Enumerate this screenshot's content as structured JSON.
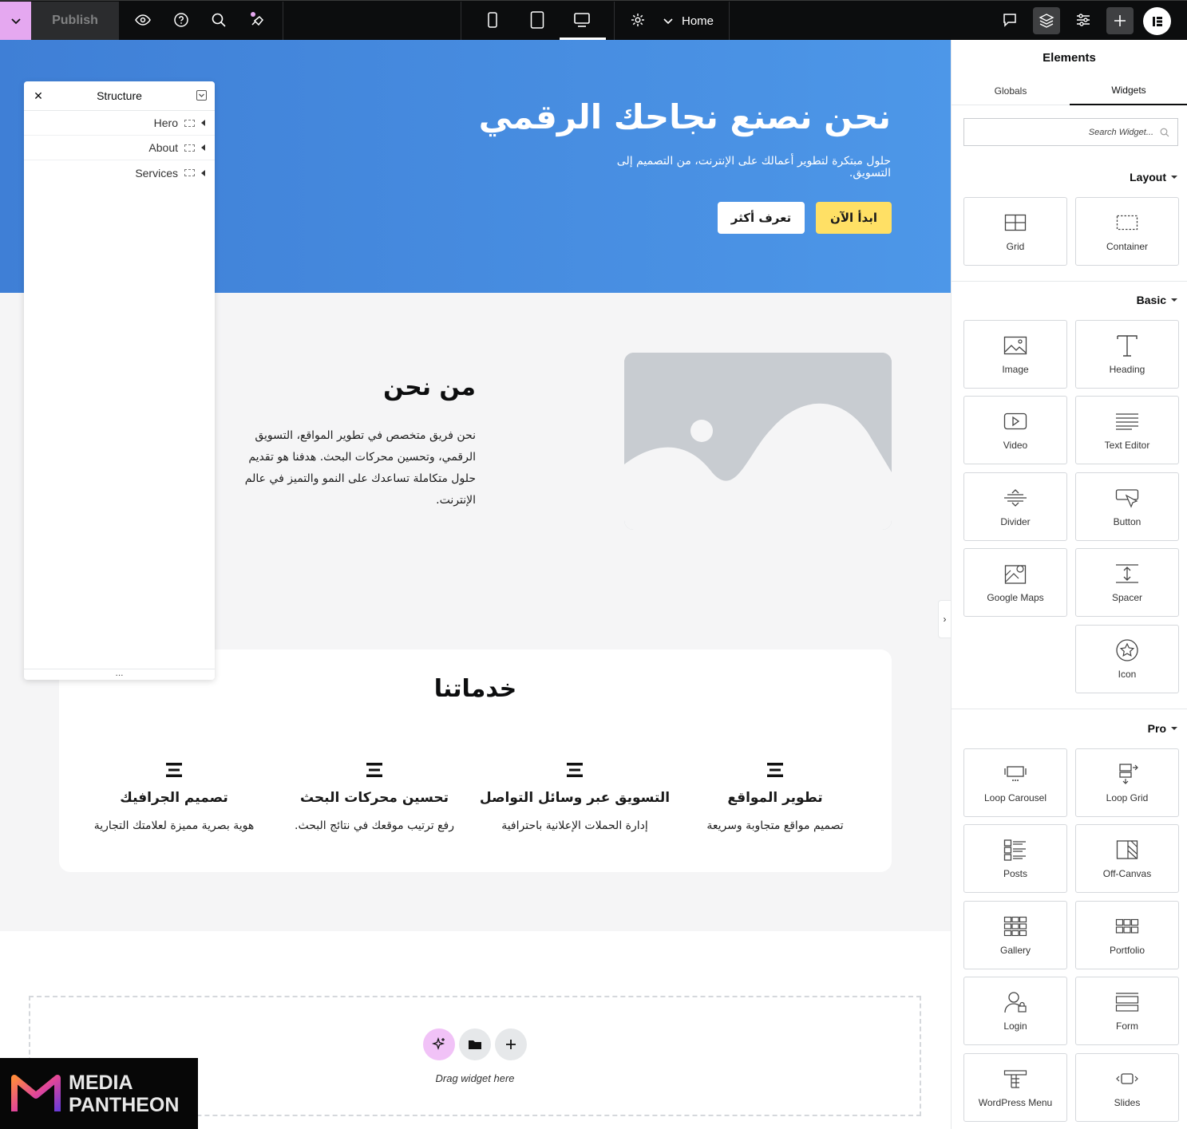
{
  "topbar": {
    "publish_label": "Publish",
    "page_label": "Home",
    "icons": [
      "chevron-down-icon",
      "eye-icon",
      "help-icon",
      "search-icon",
      "notes-icon",
      "mobile-icon",
      "tablet-icon",
      "desktop-icon",
      "settings-icon",
      "comments-icon",
      "layers-icon",
      "sliders-icon",
      "plus-icon",
      "elementor-logo"
    ]
  },
  "hero": {
    "title": "نحن نصنع نجاحك الرقمي",
    "subtitle": "حلول مبتكرة لتطوير أعمالك على الإنترنت، من التصميم إلى التسويق.",
    "start_button": "ابدأ الآن",
    "more_button": "تعرف أكثر",
    "start_color": "#ffe065"
  },
  "about": {
    "title": "من نحن",
    "text": "نحن فريق متخصص في تطوير المواقع، التسويق الرقمي، وتحسين محركات البحث. هدفنا هو تقديم حلول متكاملة تساعدك على النمو والتميز في عالم الإنترنت."
  },
  "services": {
    "title": "خدماتنا",
    "items": [
      {
        "title": "تطوير المواقع",
        "desc": "تصميم مواقع متجاوبة وسريعة"
      },
      {
        "title": "التسويق عبر وسائل التواصل",
        "desc": "إدارة الحملات الإعلانية باحترافية"
      },
      {
        "title": "تحسين محركات البحث",
        "desc": "رفع ترتيب موقعك في نتائج البحث."
      },
      {
        "title": "تصميم الجرافيك",
        "desc": "هوية بصرية مميزة لعلامتك التجارية"
      }
    ]
  },
  "dropzone": {
    "text": "Drag widget here"
  },
  "structure": {
    "title": "Structure",
    "items": [
      "Hero",
      "About",
      "Services"
    ]
  },
  "panel": {
    "title": "Elements",
    "tabs": [
      "Globals",
      "Widgets"
    ],
    "search_placeholder": "Search Widget...",
    "sections": {
      "layout": {
        "label": "Layout",
        "widgets": [
          "Grid",
          "Container"
        ]
      },
      "basic": {
        "label": "Basic",
        "widgets": [
          "Image",
          "Heading",
          "Video",
          "Text Editor",
          "Divider",
          "Button",
          "Google Maps",
          "Spacer",
          "Icon"
        ]
      },
      "pro": {
        "label": "Pro",
        "widgets": [
          "Loop Carousel",
          "Loop Grid",
          "Posts",
          "Off-Canvas",
          "Gallery",
          "Portfolio",
          "Login",
          "Form",
          "WordPress Menu",
          "Slides"
        ]
      }
    }
  },
  "watermark": {
    "line1": "MEDIA",
    "line2": "PANTHEON"
  }
}
